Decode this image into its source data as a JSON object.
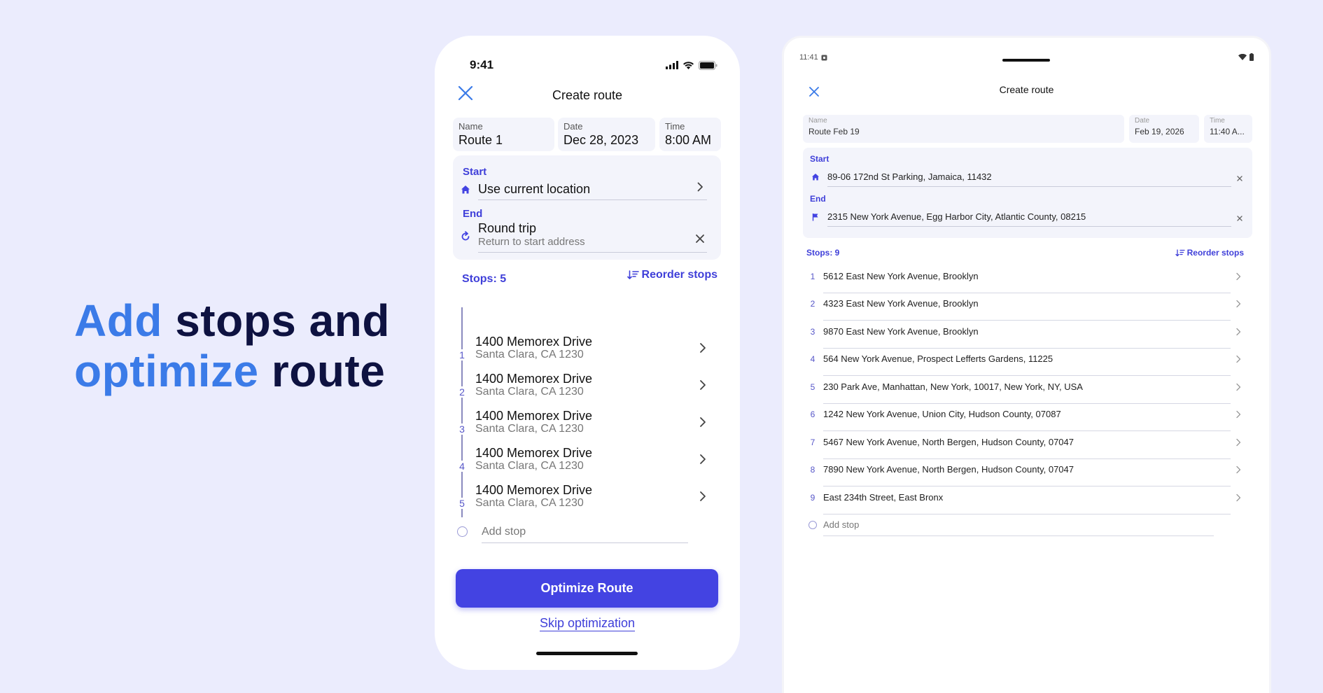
{
  "headline": {
    "line1_accent": "Add",
    "line1_rest": "stops and",
    "line2_accent": "optimize",
    "line2_rest": "route"
  },
  "colors": {
    "background": "#EBECFD",
    "accent_blue": "#3B7BE8",
    "brand_indigo": "#4343E2",
    "headline_dark": "#0E1241"
  },
  "phone": {
    "status_time": "9:41",
    "status_icons": [
      "signal-icon",
      "wifi-icon",
      "battery-icon"
    ],
    "title": "Create route",
    "name": {
      "label": "Name",
      "value": "Route 1"
    },
    "date": {
      "label": "Date",
      "value": "Dec 28, 2023"
    },
    "time": {
      "label": "Time",
      "value": "8:00 AM"
    },
    "start": {
      "label": "Start",
      "value": "Use current location"
    },
    "end": {
      "label": "End",
      "value": "Round trip",
      "subtext": "Return to start address"
    },
    "stops_count": "Stops: 5",
    "reorder": "Reorder stops",
    "stops": [
      {
        "num": "1",
        "title": "1400 Memorex Drive",
        "subtitle": "Santa Clara, CA 1230"
      },
      {
        "num": "2",
        "title": "1400 Memorex Drive",
        "subtitle": "Santa Clara, CA 1230"
      },
      {
        "num": "3",
        "title": "1400 Memorex Drive",
        "subtitle": "Santa Clara, CA 1230"
      },
      {
        "num": "4",
        "title": "1400 Memorex Drive",
        "subtitle": "Santa Clara, CA 1230"
      },
      {
        "num": "5",
        "title": "1400 Memorex Drive",
        "subtitle": "Santa Clara, CA 1230"
      }
    ],
    "add_stop": "Add stop",
    "optimize": "Optimize Route",
    "skip": "Skip optimization"
  },
  "tablet": {
    "status_time": "11:41",
    "title": "Create route",
    "name": {
      "label": "Name",
      "value": "Route Feb 19"
    },
    "date": {
      "label": "Date",
      "value": "Feb 19, 2026"
    },
    "time": {
      "label": "Time",
      "value": "11:40 A..."
    },
    "start": {
      "label": "Start",
      "value": "89-06 172nd St Parking, Jamaica, 11432"
    },
    "end": {
      "label": "End",
      "value": "2315 New York Avenue, Egg Harbor City, Atlantic County, 08215"
    },
    "stops_count": "Stops: 9",
    "reorder": "Reorder stops",
    "stops": [
      {
        "num": "1",
        "address": "5612 East New York Avenue, Brooklyn"
      },
      {
        "num": "2",
        "address": "4323 East New York Avenue, Brooklyn"
      },
      {
        "num": "3",
        "address": "9870 East New York Avenue, Brooklyn"
      },
      {
        "num": "4",
        "address": "564 New York Avenue, Prospect Lefferts Gardens, 11225"
      },
      {
        "num": "5",
        "address": "230 Park Ave, Manhattan, New York, 10017, New York, NY, USA"
      },
      {
        "num": "6",
        "address": "1242 New York Avenue, Union City, Hudson County, 07087"
      },
      {
        "num": "7",
        "address": "5467 New York Avenue, North Bergen, Hudson County, 07047"
      },
      {
        "num": "8",
        "address": "7890 New York Avenue, North Bergen, Hudson County, 07047"
      },
      {
        "num": "9",
        "address": "East 234th Street, East Bronx"
      }
    ],
    "add_stop": "Add stop"
  }
}
